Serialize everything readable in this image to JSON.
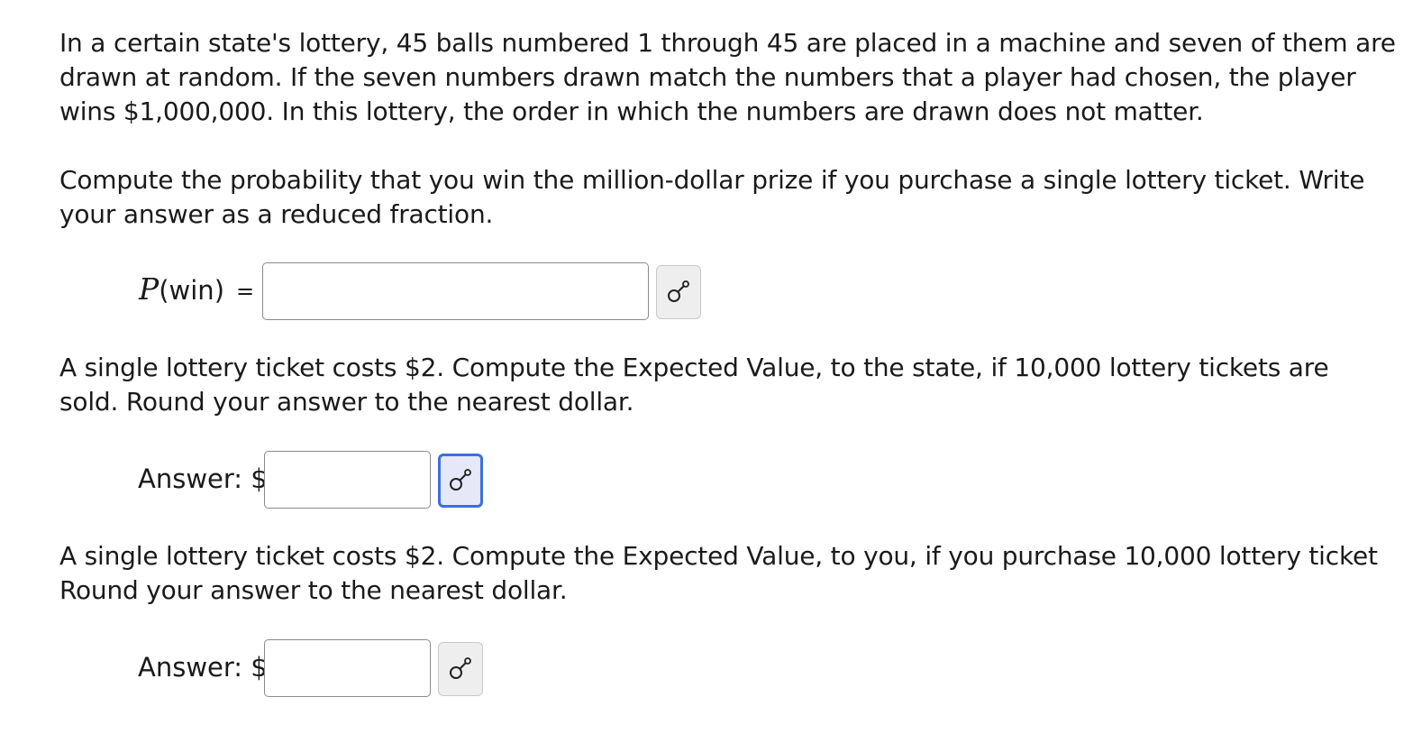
{
  "question": {
    "intro_lines": [
      "In a certain state's lottery, 45 balls numbered 1 through 45 are placed in a machine and seven of them are",
      "drawn at random. If the seven numbers drawn match the numbers that a player had chosen, the player",
      "wins $1,000,000. In this lottery, the order in which the numbers are drawn does not matter."
    ],
    "part1_lines": [
      "Compute the probability that you win the million-dollar prize if you purchase a single lottery ticket. Write",
      "your answer as a reduced fraction."
    ],
    "part2_lines": [
      "A single lottery ticket costs $2. Compute the Expected Value, to the state, if 10,000 lottery tickets are",
      "sold. Round your answer to the nearest dollar."
    ],
    "part3_lines": [
      "A single lottery ticket costs $2. Compute the Expected Value, to you, if you purchase 10,000 lottery ticket",
      "Round your answer to the nearest dollar."
    ]
  },
  "answers": {
    "p_win": {
      "var": "P",
      "label_suffix": "(win)",
      "equals": "=",
      "value": ""
    },
    "state_ev": {
      "label": "Answer: $",
      "value": ""
    },
    "you_ev": {
      "label": "Answer: $",
      "value": ""
    }
  },
  "tools": {
    "icon": "math-editor-key-icon",
    "focused_index": 1
  },
  "colors": {
    "focus_border": "#3b6fe0",
    "focus_fill": "#e6e8f8",
    "button_fill": "#eeeeee"
  }
}
